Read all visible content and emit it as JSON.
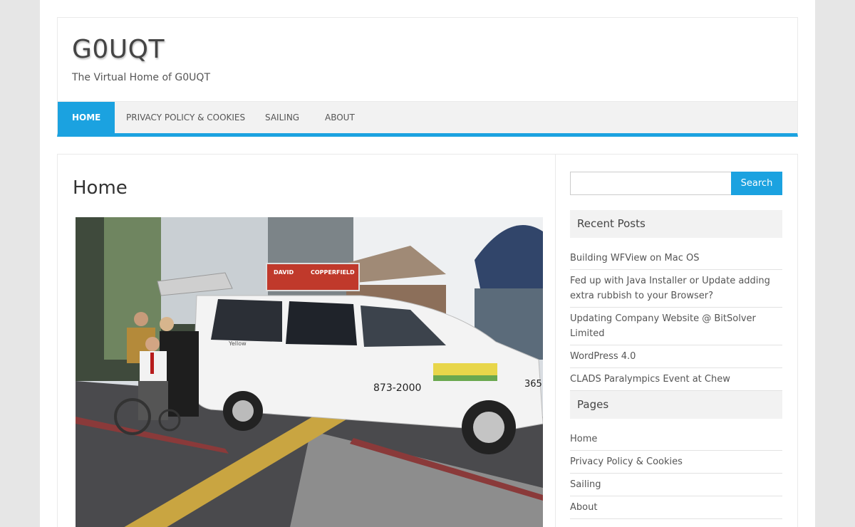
{
  "site": {
    "title": "G0UQT",
    "description": "The Virtual Home of G0UQT"
  },
  "nav": {
    "items": [
      {
        "label": "Home",
        "active": true
      },
      {
        "label": "Privacy Policy & Cookies"
      },
      {
        "label": "Sailing"
      },
      {
        "label": "About"
      }
    ]
  },
  "main": {
    "heading": "Home",
    "photo_signs": {
      "topper_text": "DAVID COPPERFIELD",
      "phone": "873-2000",
      "fleet_no": "365",
      "logo": "Yellow"
    }
  },
  "sidebar": {
    "search_button": "Search",
    "recent_posts": {
      "title": "Recent Posts",
      "items": [
        "Building WFView on Mac OS",
        "Fed up with Java Installer or Update adding extra rubbish to your Browser?",
        "Updating Company Website @ BitSolver Limited",
        "WordPress 4.0",
        "CLADS Paralympics Event at Chew"
      ]
    },
    "pages": {
      "title": "Pages",
      "items": [
        "Home",
        "Privacy Policy & Cookies",
        "Sailing",
        "About"
      ]
    }
  },
  "colors": {
    "accent": "#1ba2e0",
    "background": "#e6e6e6"
  }
}
